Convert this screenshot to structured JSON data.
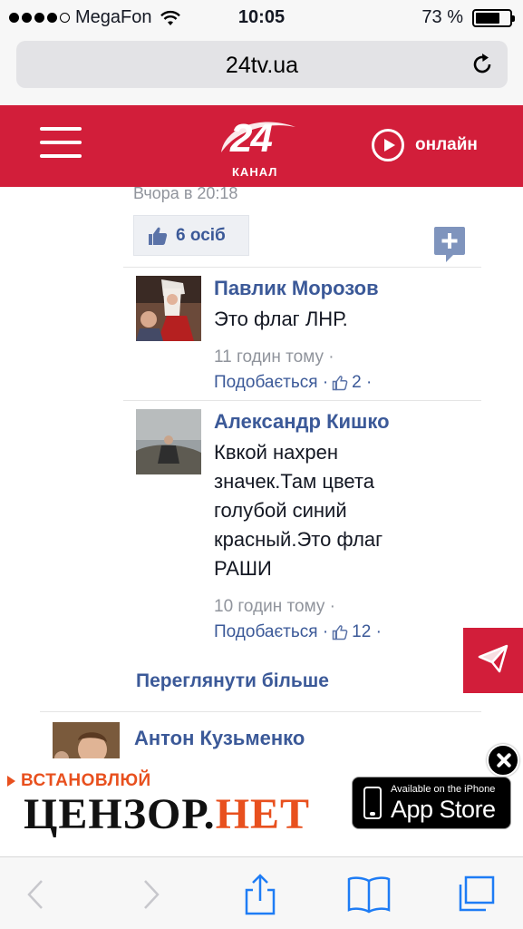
{
  "status_bar": {
    "carrier": "MegaFon",
    "signal_bars": 4,
    "signal_max": 5,
    "time": "10:05",
    "battery_text": "73 %",
    "battery_level": 0.73
  },
  "url_bar": {
    "url": "24tv.ua"
  },
  "site_header": {
    "logo_number": "24",
    "logo_subtitle": "КАНАЛ",
    "online_label": "онлайн",
    "brand_color": "#d21e3a"
  },
  "comments_section": {
    "previous_comment_time": "Вчора в 20:18",
    "likes_label": "6 осіб",
    "comments": [
      {
        "author": "Павлик Морозов",
        "lines": [
          "Это флаг ЛНР."
        ],
        "time": "11 годин тому ·",
        "like_label": "Подобається ·",
        "like_count": "2 ·"
      },
      {
        "author": "Александр Кишко",
        "lines": [
          "Квкой нахрен",
          "значек.Там цвета",
          "голубой синий",
          "красный.Это флаг",
          "РАШИ"
        ],
        "time": "10 годин тому ·",
        "like_label": "Подобається ·",
        "like_count": "12 ·"
      }
    ],
    "see_more": "Переглянути більше",
    "next_author": "Антон Кузьменко",
    "link_color": "#3b5998"
  },
  "ad_banner": {
    "install_text": "ВСТАНОВЛЮЙ",
    "brand_part1": "ЦЕНЗОР.",
    "brand_part2": "НЕТ",
    "appstore_small": "Available on the iPhone",
    "appstore_big": "App Store",
    "accent_color": "#e8501e"
  },
  "toolbar": {
    "icons": [
      "back-icon",
      "forward-icon",
      "share-icon",
      "bookmarks-icon",
      "tabs-icon"
    ]
  }
}
